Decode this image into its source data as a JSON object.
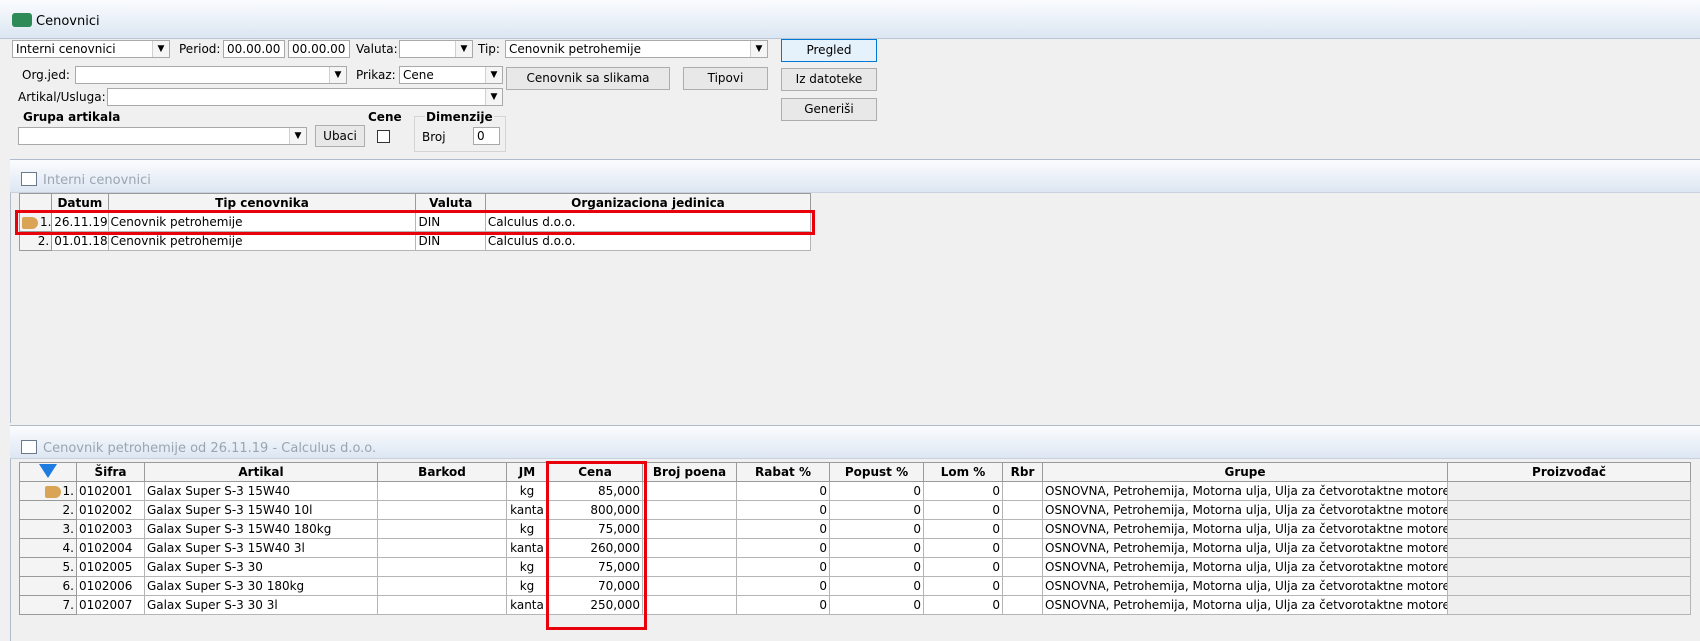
{
  "window": {
    "title": "Cenovnici",
    "icon": "app-logo-icon"
  },
  "filters": {
    "type_select": "Interni cenovnici",
    "period_label": "Period:",
    "period_from": "00.00.00",
    "period_to": "00.00.00",
    "currency_label": "Valuta:",
    "currency_value": "",
    "tip_label": "Tip:",
    "tip_value": "Cenovnik petrohemije",
    "orgjed_label": "Org.jed:",
    "orgjed_value": "",
    "prikaz_label": "Prikaz:",
    "prikaz_value": "Cene",
    "artikal_label": "Artikal/Usluga:",
    "artikal_value": "",
    "grupa_label": "Grupa artikala",
    "grupa_value": "",
    "ubaci_label": "Ubaci",
    "cene_label": "Cene",
    "dimenzije_label": "Dimenzije",
    "broj_label": "Broj",
    "broj_value": "0"
  },
  "buttons": {
    "pregled": "Pregled",
    "iz_datoteke": "Iz datoteke",
    "generisi": "Generiši",
    "cenovnik_sa_slikama": "Cenovnik sa slikama",
    "tipovi": "Tipovi"
  },
  "pricelists_panel": {
    "title": "Interni cenovnici",
    "columns": [
      "Datum",
      "Tip cenovnika",
      "Valuta",
      "Organizaciona jedinica"
    ],
    "rows": [
      {
        "n": "1.",
        "datum": "26.11.19",
        "tip": "Cenovnik petrohemije",
        "valuta": "DIN",
        "org": "Calculus d.o.o."
      },
      {
        "n": "2.",
        "datum": "01.01.18",
        "tip": "Cenovnik petrohemije",
        "valuta": "DIN",
        "org": "Calculus d.o.o."
      }
    ]
  },
  "items_panel": {
    "title": "Cenovnik petrohemije od 26.11.19 - Calculus d.o.o.",
    "columns": [
      "Šifra",
      "Artikal",
      "Barkod",
      "JM",
      "Cena",
      "Broj poena",
      "Rabat %",
      "Popust %",
      "Lom %",
      "Rbr",
      "Grupe",
      "Proizvođač"
    ],
    "rows": [
      {
        "n": "1.",
        "sifra": "0102001",
        "artikal": "Galax Super S-3 15W40",
        "barkod": "",
        "jm": "kg",
        "cena": "85,000",
        "poeni": "",
        "rabat": "0",
        "popust": "0",
        "lom": "0",
        "rbr": "",
        "grupe": "OSNOVNA, Petrohemija, Motorna ulja, Ulja za četvorotaktne motore",
        "proizvodjac": ""
      },
      {
        "n": "2.",
        "sifra": "0102002",
        "artikal": "Galax Super S-3 15W40 10l",
        "barkod": "",
        "jm": "kanta",
        "cena": "800,000",
        "poeni": "",
        "rabat": "0",
        "popust": "0",
        "lom": "0",
        "rbr": "",
        "grupe": "OSNOVNA, Petrohemija, Motorna ulja, Ulja za četvorotaktne motore",
        "proizvodjac": ""
      },
      {
        "n": "3.",
        "sifra": "0102003",
        "artikal": "Galax Super S-3 15W40 180kg",
        "barkod": "",
        "jm": "kg",
        "cena": "75,000",
        "poeni": "",
        "rabat": "0",
        "popust": "0",
        "lom": "0",
        "rbr": "",
        "grupe": "OSNOVNA, Petrohemija, Motorna ulja, Ulja za četvorotaktne motore",
        "proizvodjac": ""
      },
      {
        "n": "4.",
        "sifra": "0102004",
        "artikal": "Galax Super S-3 15W40 3l",
        "barkod": "",
        "jm": "kanta",
        "cena": "260,000",
        "poeni": "",
        "rabat": "0",
        "popust": "0",
        "lom": "0",
        "rbr": "",
        "grupe": "OSNOVNA, Petrohemija, Motorna ulja, Ulja za četvorotaktne motore",
        "proizvodjac": ""
      },
      {
        "n": "5.",
        "sifra": "0102005",
        "artikal": "Galax Super S-3 30",
        "barkod": "",
        "jm": "kg",
        "cena": "75,000",
        "poeni": "",
        "rabat": "0",
        "popust": "0",
        "lom": "0",
        "rbr": "",
        "grupe": "OSNOVNA, Petrohemija, Motorna ulja, Ulja za četvorotaktne motore",
        "proizvodjac": ""
      },
      {
        "n": "6.",
        "sifra": "0102006",
        "artikal": "Galax Super S-3 30 180kg",
        "barkod": "",
        "jm": "kg",
        "cena": "70,000",
        "poeni": "",
        "rabat": "0",
        "popust": "0",
        "lom": "0",
        "rbr": "",
        "grupe": "OSNOVNA, Petrohemija, Motorna ulja, Ulja za četvorotaktne motore",
        "proizvodjac": ""
      },
      {
        "n": "7.",
        "sifra": "0102007",
        "artikal": "Galax Super S-3 30 3l",
        "barkod": "",
        "jm": "kanta",
        "cena": "250,000",
        "poeni": "",
        "rabat": "0",
        "popust": "0",
        "lom": "0",
        "rbr": "",
        "grupe": "OSNOVNA, Petrohemija, Motorna ulja, Ulja za četvorotaktne motore",
        "proizvodjac": ""
      }
    ]
  },
  "colors": {
    "highlight": "#e8000a",
    "accent": "#0078d7"
  }
}
